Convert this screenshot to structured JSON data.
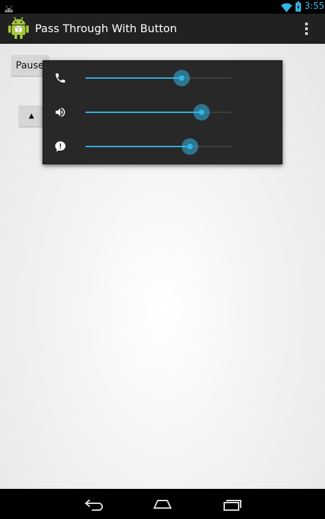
{
  "status_bar": {
    "time": "3:55",
    "icons": [
      "android-notification-icon",
      "wifi-icon",
      "battery-charging-icon"
    ],
    "accent_color": "#33b5e5"
  },
  "action_bar": {
    "title": "Pass Through With Button",
    "app_icon": "android-robot-icon",
    "overflow_icon": "overflow-menu-icon"
  },
  "content": {
    "pause_label": "Pause",
    "up_label": "▲"
  },
  "volume_panel": {
    "streams": [
      {
        "icon": "phone-icon",
        "level": 0.66
      },
      {
        "icon": "speaker-icon",
        "level": 0.795
      },
      {
        "icon": "notification-icon",
        "level": 0.715
      }
    ],
    "slider_color": "#33b5e5"
  },
  "nav_bar": {
    "buttons": [
      "back-icon",
      "home-icon",
      "recent-apps-icon"
    ]
  }
}
